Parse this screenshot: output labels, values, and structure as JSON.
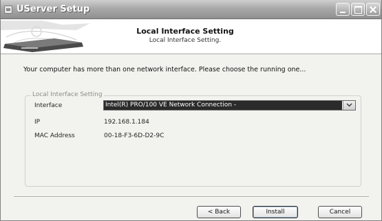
{
  "window": {
    "title": "UServer Setup"
  },
  "header": {
    "title": "Local Interface Setting",
    "subtitle": "Local Interface Setting."
  },
  "instruction": "Your computer has more than one network interface. Please choose the running one...",
  "group": {
    "legend": "Local Interface Setting",
    "interface_label": "Interface",
    "interface_value": "Intel(R) PRO/100 VE Network Connection -",
    "ip_label": "IP",
    "ip_value": "192.168.1.184",
    "mac_label": "MAC Address",
    "mac_value": "00-18-F3-6D-D2-9C"
  },
  "buttons": {
    "back": "< Back",
    "install": "Install",
    "cancel": "Cancel"
  }
}
